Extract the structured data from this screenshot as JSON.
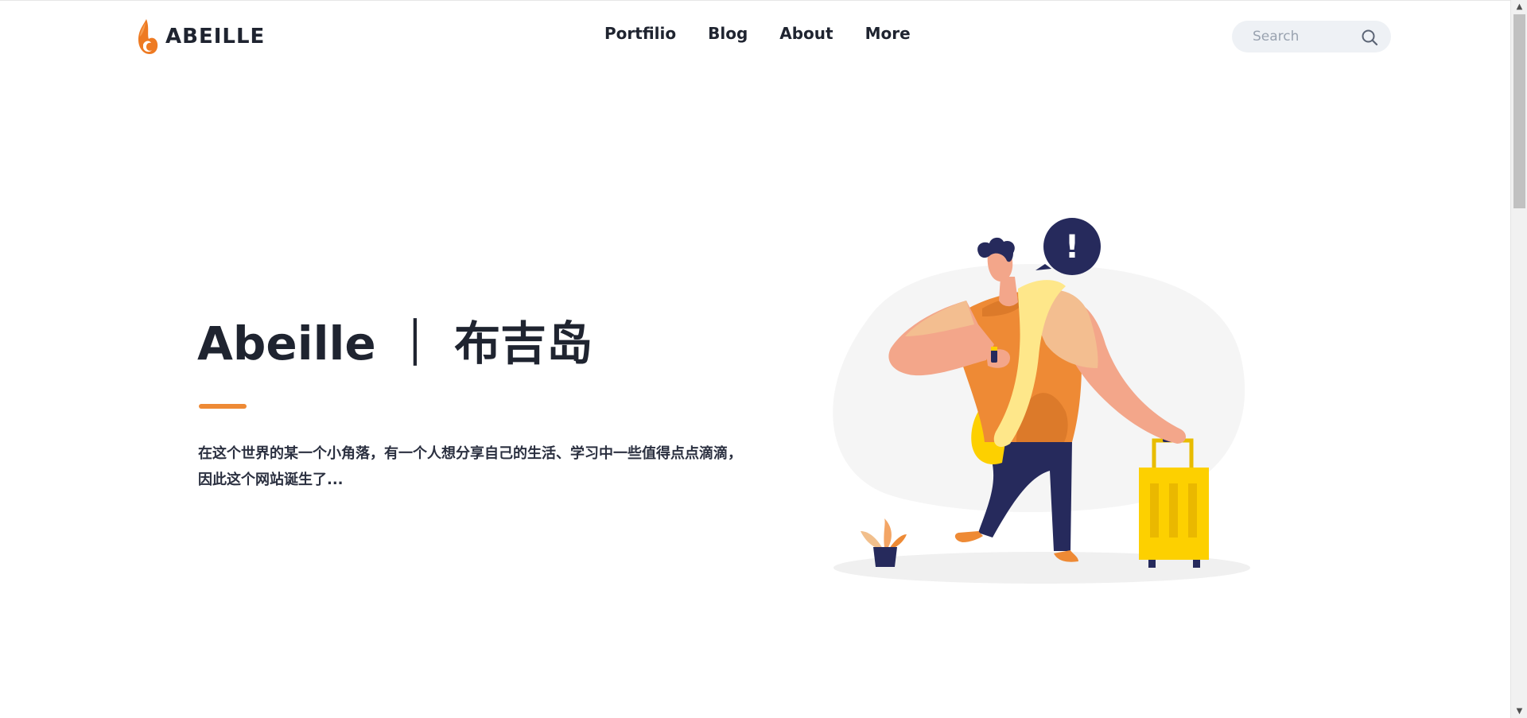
{
  "header": {
    "logo_text": "ABEILLE",
    "nav": {
      "portfolio": "Portfilio",
      "blog": "Blog",
      "about": "About",
      "more": "More"
    },
    "search": {
      "placeholder": "Search",
      "icon": "search-icon"
    }
  },
  "hero": {
    "title": "Abeille ｜ 布吉岛",
    "description": "在这个世界的某一个小角落，有一个人想分享自己的生活、学习中一些值得点点滴滴，因此这个网站诞生了...",
    "accent_color": "#ee8a35"
  },
  "illustration": {
    "bubble_text": "!"
  },
  "colors": {
    "text": "#1f2430",
    "accent": "#ee8a35",
    "navy": "#262a5c",
    "yellow": "#fdd000"
  }
}
